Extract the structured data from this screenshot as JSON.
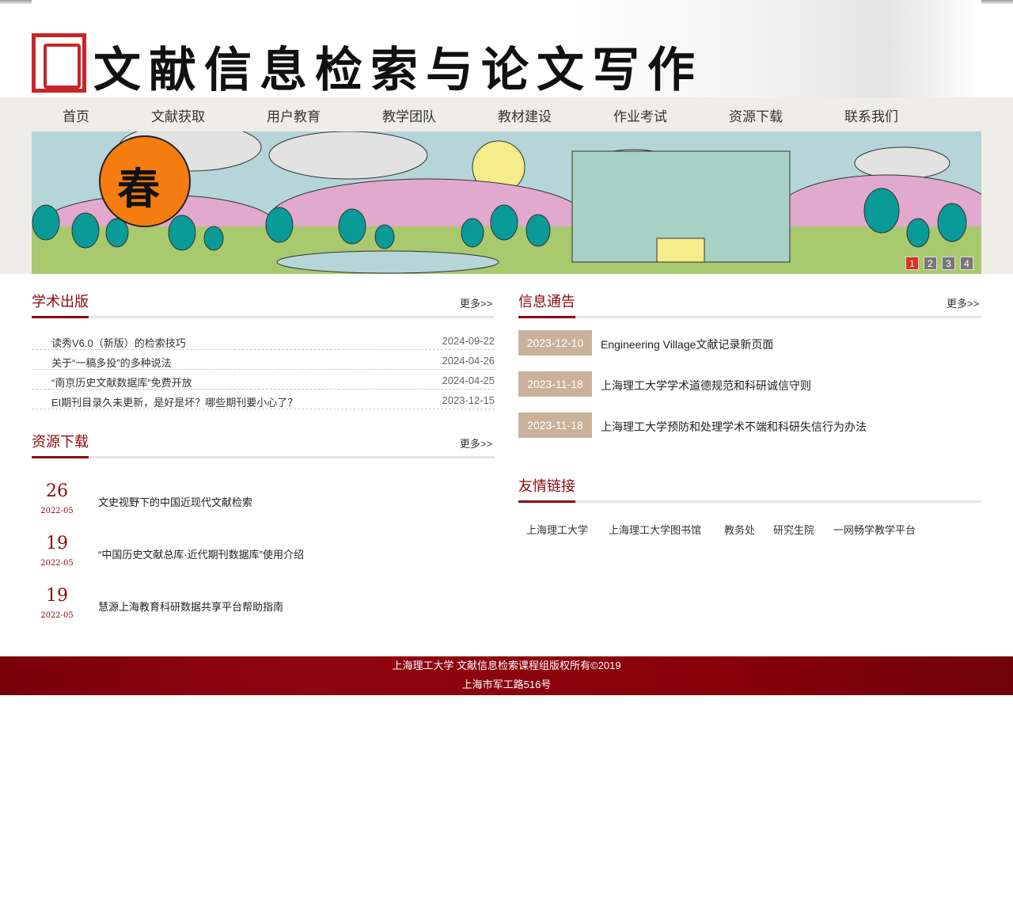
{
  "header": {
    "title": "文献信息检索与论文写作"
  },
  "nav": [
    "首页",
    "文献获取",
    "用户教育",
    "教学团队",
    "教材建设",
    "作业考试",
    "资源下载",
    "联系我们"
  ],
  "banner": {
    "badge": "春",
    "pages": [
      "1",
      "2",
      "3",
      "4"
    ],
    "active_page": 1
  },
  "academic": {
    "title": "学术出版",
    "more": "更多>>",
    "items": [
      {
        "title": "读秀V6.0（新版）的检索技巧",
        "date": "2024-09-22"
      },
      {
        "title": "关于“一稿多投”的多种说法",
        "date": "2024-04-26"
      },
      {
        "title": "“南京历史文献数据库”免费开放",
        "date": "2024-04-25"
      },
      {
        "title": "EI期刊目录久未更新，是好是坏？哪些期刊要小心了？",
        "date": "2023-12-15"
      }
    ]
  },
  "notices": {
    "title": "信息通告",
    "more": "更多>>",
    "items": [
      {
        "date": "2023-12-10",
        "title": "Engineering Village文献记录新页面"
      },
      {
        "date": "2023-11-18",
        "title": "上海理工大学学术道德规范和科研诚信守则"
      },
      {
        "date": "2023-11-18",
        "title": "上海理工大学预防和处理学术不端和科研失信行为办法"
      }
    ]
  },
  "resources": {
    "title": "资源下载",
    "more": "更多>>",
    "items": [
      {
        "day": "26",
        "ym": "2022-05",
        "title": "文史视野下的中国近现代文献检索"
      },
      {
        "day": "19",
        "ym": "2022-05",
        "title": "“中国历史文献总库·近代期刊数据库”使用介绍"
      },
      {
        "day": "19",
        "ym": "2022-05",
        "title": "慧源上海教育科研数据共享平台帮助指南"
      }
    ]
  },
  "links": {
    "title": "友情链接",
    "items": [
      "上海理工大学",
      "上海理工大学图书馆",
      "教务处",
      "研究生院",
      "一网畅学教学平台"
    ]
  },
  "footer": {
    "line1": "上海理工大学 文献信息检索课程组版权所有©2019",
    "line2": "上海市军工路516号"
  }
}
